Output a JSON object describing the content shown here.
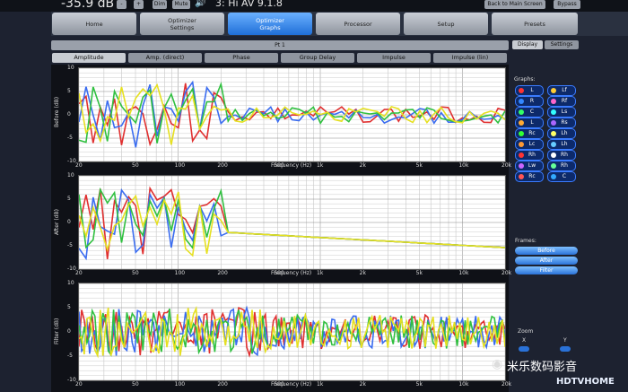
{
  "header": {
    "volume": "-35.9 dB",
    "btn_minus": "-",
    "btn_plus": "+",
    "dim": "Dim",
    "mute": "Mute",
    "preset": "3: Hi AV 9.1.8",
    "back": "Back to Main Screen",
    "bypass": "Bypass"
  },
  "tabs": [
    {
      "line1": "Home",
      "line2": ""
    },
    {
      "line1": "Optimizer",
      "line2": "Settings"
    },
    {
      "line1": "Optimizer",
      "line2": "Graphs"
    },
    {
      "line1": "Processor",
      "line2": ""
    },
    {
      "line1": "Setup",
      "line2": ""
    },
    {
      "line1": "Presets",
      "line2": ""
    }
  ],
  "pt_label": "Pt 1",
  "subtabs": [
    "Amplitude",
    "Amp. (direct)",
    "Phase",
    "Group Delay",
    "Impulse",
    "Impulse (lin)"
  ],
  "side_tabs": {
    "display": "Display",
    "settings": "Settings"
  },
  "graphs_label": "Graphs:",
  "graph_buttons": [
    {
      "l": "L",
      "c": "#ff3333"
    },
    {
      "l": "Lf",
      "c": "#ffcc33"
    },
    {
      "l": "R",
      "c": "#3388ff"
    },
    {
      "l": "Rf",
      "c": "#ff66cc"
    },
    {
      "l": "C",
      "c": "#33ff66"
    },
    {
      "l": "Ls",
      "c": "#33ffff"
    },
    {
      "l": "L",
      "c": "#ffaa33"
    },
    {
      "l": "Rs",
      "c": "#aa66ff"
    },
    {
      "l": "Rc",
      "c": "#33ff33"
    },
    {
      "l": "Lh",
      "c": "#ffff66"
    },
    {
      "l": "Lc",
      "c": "#ff9933"
    },
    {
      "l": "Lh",
      "c": "#66ccff"
    },
    {
      "l": "Rh",
      "c": "#ff3333"
    },
    {
      "l": "Rh",
      "c": "#ffffff"
    },
    {
      "l": "Lw",
      "c": "#cc66ff"
    },
    {
      "l": "Rh",
      "c": "#66ff99"
    },
    {
      "l": "Rc",
      "c": "#ff5555"
    },
    {
      "l": "C",
      "c": "#33aaff"
    }
  ],
  "frames_label": "Frames:",
  "frames": [
    "Before",
    "After",
    "Filter"
  ],
  "zoom": {
    "label": "Zoom",
    "x": "X",
    "y": "Y"
  },
  "x_ticks": [
    "20",
    "50",
    "100",
    "200",
    "500",
    "1k",
    "2k",
    "5k",
    "10k",
    "20k"
  ],
  "freq_label": "Frequency (Hz)",
  "panels": [
    {
      "ylabel": "Before (dB)",
      "yticks": [
        "10",
        "5",
        "0",
        "-5",
        "-10"
      ]
    },
    {
      "ylabel": "After (dB)",
      "yticks": [
        "10",
        "5",
        "0",
        "-5",
        "-10"
      ]
    },
    {
      "ylabel": "Filter (dB)",
      "yticks": [
        "10",
        "5",
        "0",
        "-5",
        "-10"
      ]
    }
  ],
  "watermark": {
    "cn": "米乐数码影音",
    "site": "HDTVHOME"
  },
  "colors": {
    "red": "#e03030",
    "blue": "#3a6cf0",
    "green": "#30c040",
    "yellow": "#e6e020",
    "accent": "#2a72d8"
  }
}
